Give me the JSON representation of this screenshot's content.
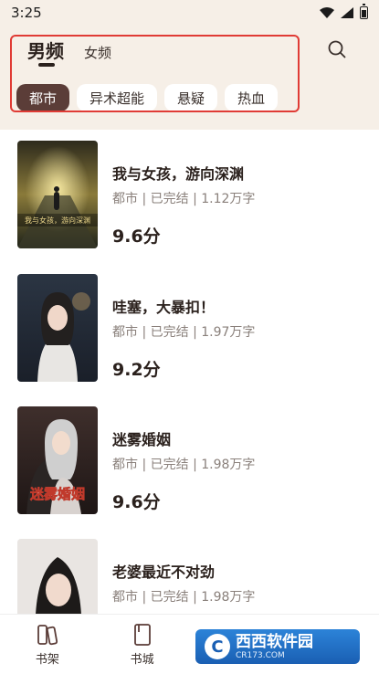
{
  "status_bar": {
    "time": "3:25"
  },
  "header": {
    "tabs": [
      {
        "label": "男频"
      },
      {
        "label": "女频"
      }
    ],
    "categories": [
      {
        "label": "都市"
      },
      {
        "label": "异术超能"
      },
      {
        "label": "悬疑"
      },
      {
        "label": "热血"
      }
    ]
  },
  "books": [
    {
      "title": "我与女孩，游向深渊",
      "meta": "都市 | 已完结 | 1.12万字",
      "score": "9.6分",
      "cover_text": "我与女孩，游向深渊"
    },
    {
      "title": "哇塞，大暴扣！",
      "meta": "都市 | 已完结 | 1.97万字",
      "score": "9.2分"
    },
    {
      "title": "迷雾婚姻",
      "meta": "都市 | 已完结 | 1.98万字",
      "score": "9.6分",
      "cover_text": "迷雾婚姻"
    },
    {
      "title": "老婆最近不对劲",
      "meta": "都市 | 已完结 | 1.98万字",
      "score": ""
    }
  ],
  "bottom_nav": {
    "items": [
      {
        "label": "书架",
        "icon": "bookshelf-icon"
      },
      {
        "label": "书城",
        "icon": "bookstore-icon"
      }
    ]
  },
  "watermark": {
    "title": "西西软件园",
    "subtitle": "CR173.COM"
  },
  "colors": {
    "accent": "#5b3d38",
    "header_bg": "#f6efe7",
    "highlight": "#e03b35"
  }
}
